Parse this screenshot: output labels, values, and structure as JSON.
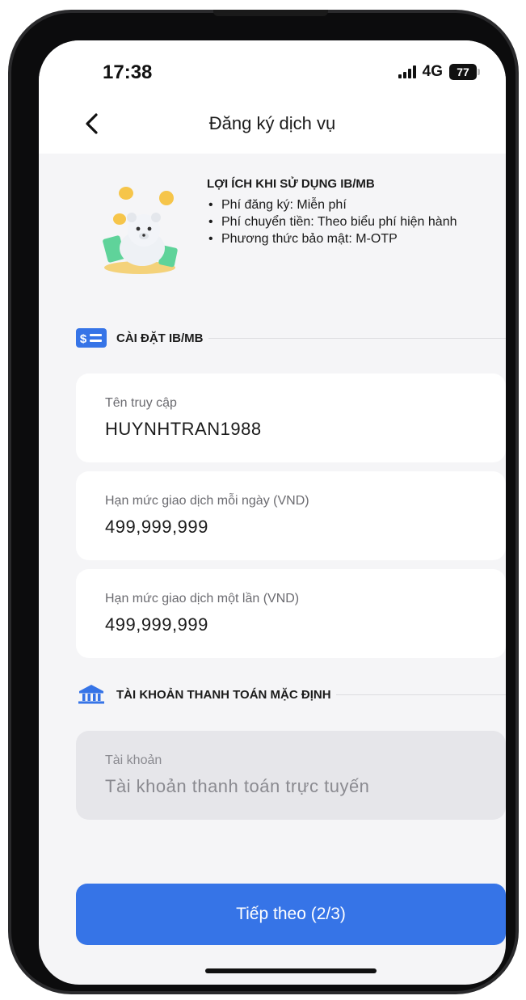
{
  "status_bar": {
    "time": "17:38",
    "network": "4G",
    "battery": "77"
  },
  "header": {
    "title": "Đăng ký dịch vụ"
  },
  "benefits": {
    "title": "LỢI ÍCH KHI SỬ DỤNG IB/MB",
    "items": [
      "Phí đăng ký: Miễn phí",
      "Phí chuyển tiền: Theo biểu phí hiện hành",
      "Phương thức bảo mật: M-OTP"
    ]
  },
  "section_setup": {
    "title": "CÀI ĐẶT IB/MB",
    "icon": "money-list-icon"
  },
  "fields": {
    "username": {
      "label": "Tên truy cập",
      "value": "HUYNHTRAN1988"
    },
    "daily_limit": {
      "label": "Hạn mức giao dịch mỗi ngày (VND)",
      "value": "499,999,999"
    },
    "per_tx_limit": {
      "label": "Hạn mức giao dịch một lần (VND)",
      "value": "499,999,999"
    }
  },
  "section_account": {
    "title": "TÀI KHOẢN THANH TOÁN MẶC ĐỊNH",
    "icon": "bank-icon"
  },
  "account_field": {
    "label": "Tài khoản",
    "placeholder": "Tài khoản thanh toán trực tuyến"
  },
  "next_button": {
    "label": "Tiếp theo (2/3)"
  },
  "colors": {
    "primary": "#3674e7",
    "background": "#f5f5f7"
  }
}
